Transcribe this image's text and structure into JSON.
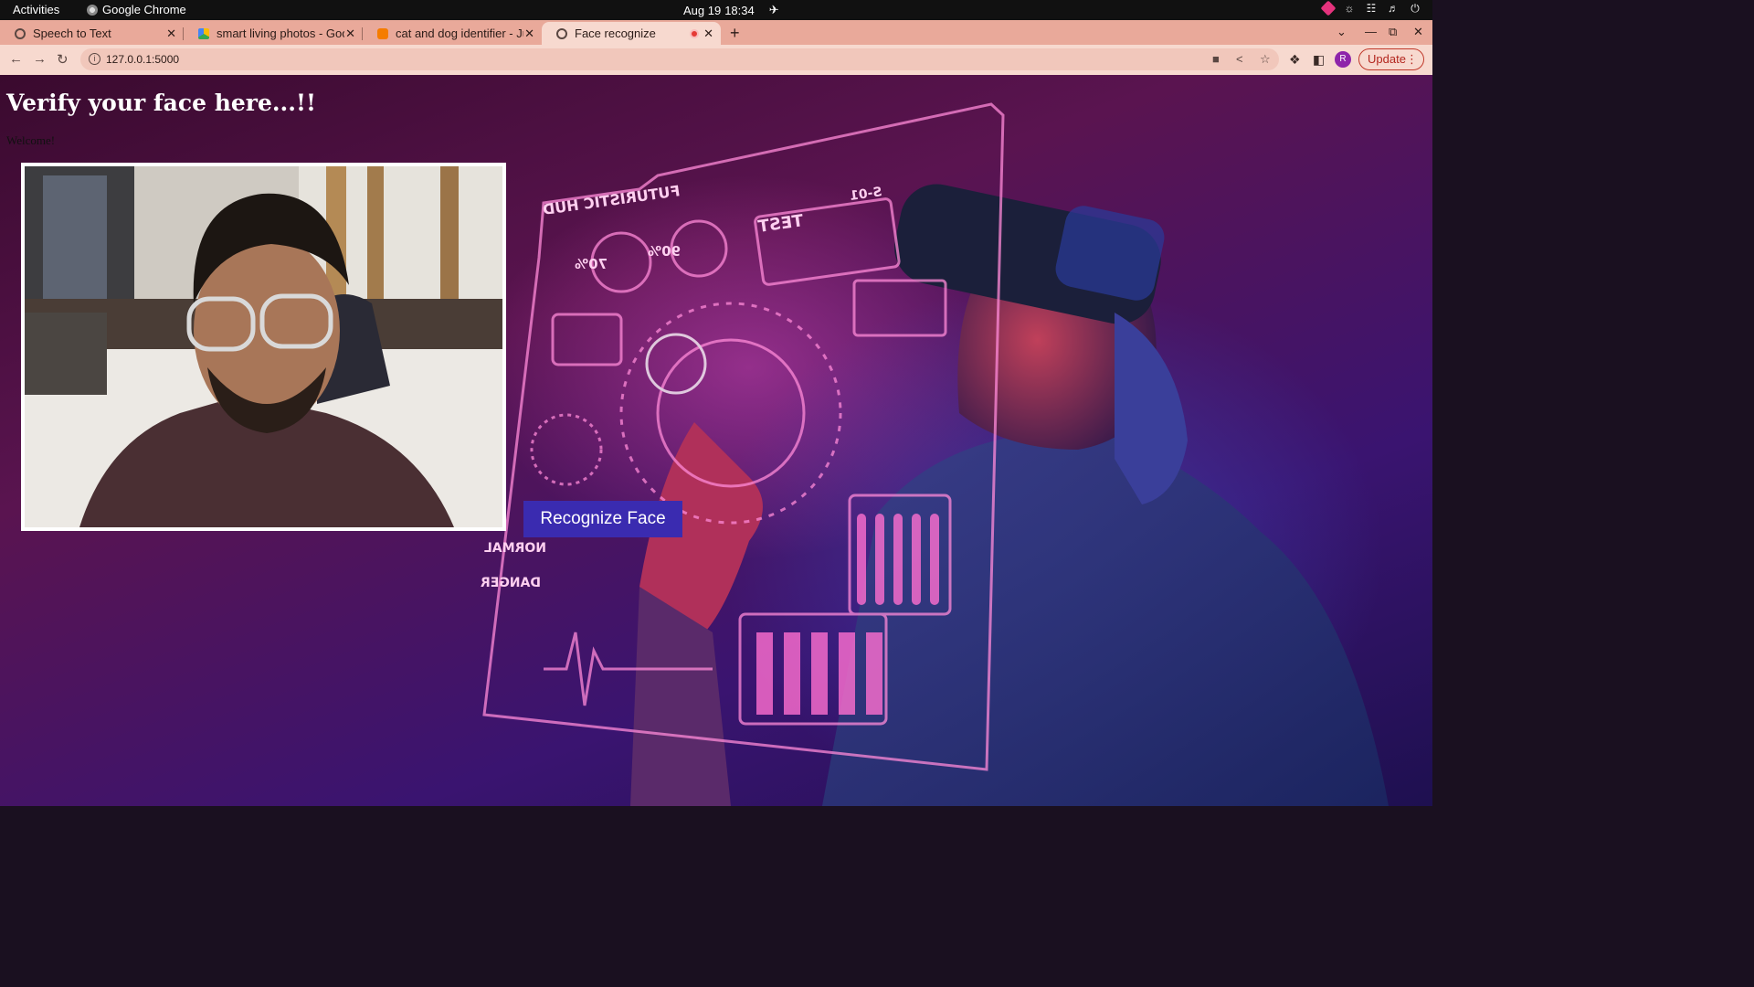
{
  "system": {
    "activities": "Activities",
    "app_name": "Google Chrome",
    "date": "Aug 19",
    "time": "18:34"
  },
  "tabs": [
    {
      "title": "Speech to Text",
      "favicon_color": "#5a4742"
    },
    {
      "title": "smart living photos - Goo",
      "favicon_color": "#34a853"
    },
    {
      "title": "cat and dog identifier - Ju",
      "favicon_color": "#f57c00"
    },
    {
      "title": "Face recognize",
      "favicon_color": "#5a4742",
      "recording": true
    }
  ],
  "address_bar": {
    "url": "127.0.0.1:5000"
  },
  "profile": {
    "initial": "R",
    "color": "#8e24aa"
  },
  "update_button": {
    "label": "Update"
  },
  "page": {
    "title": "Verify your face here...!!",
    "welcome": "Welcome!",
    "recognize_button": "Recognize Face"
  },
  "hud_text": {
    "header": "FUTURISTIC HUD",
    "test": "TEST",
    "code": "S-01",
    "gauge_1": "70%",
    "gauge_2": "90%",
    "normal": "NORMAL",
    "danger": "DANGER"
  },
  "colors": {
    "button_bg": "#3a2bb0",
    "tabstrip": "#e9a99a",
    "toolbar": "#f7d9cf"
  }
}
